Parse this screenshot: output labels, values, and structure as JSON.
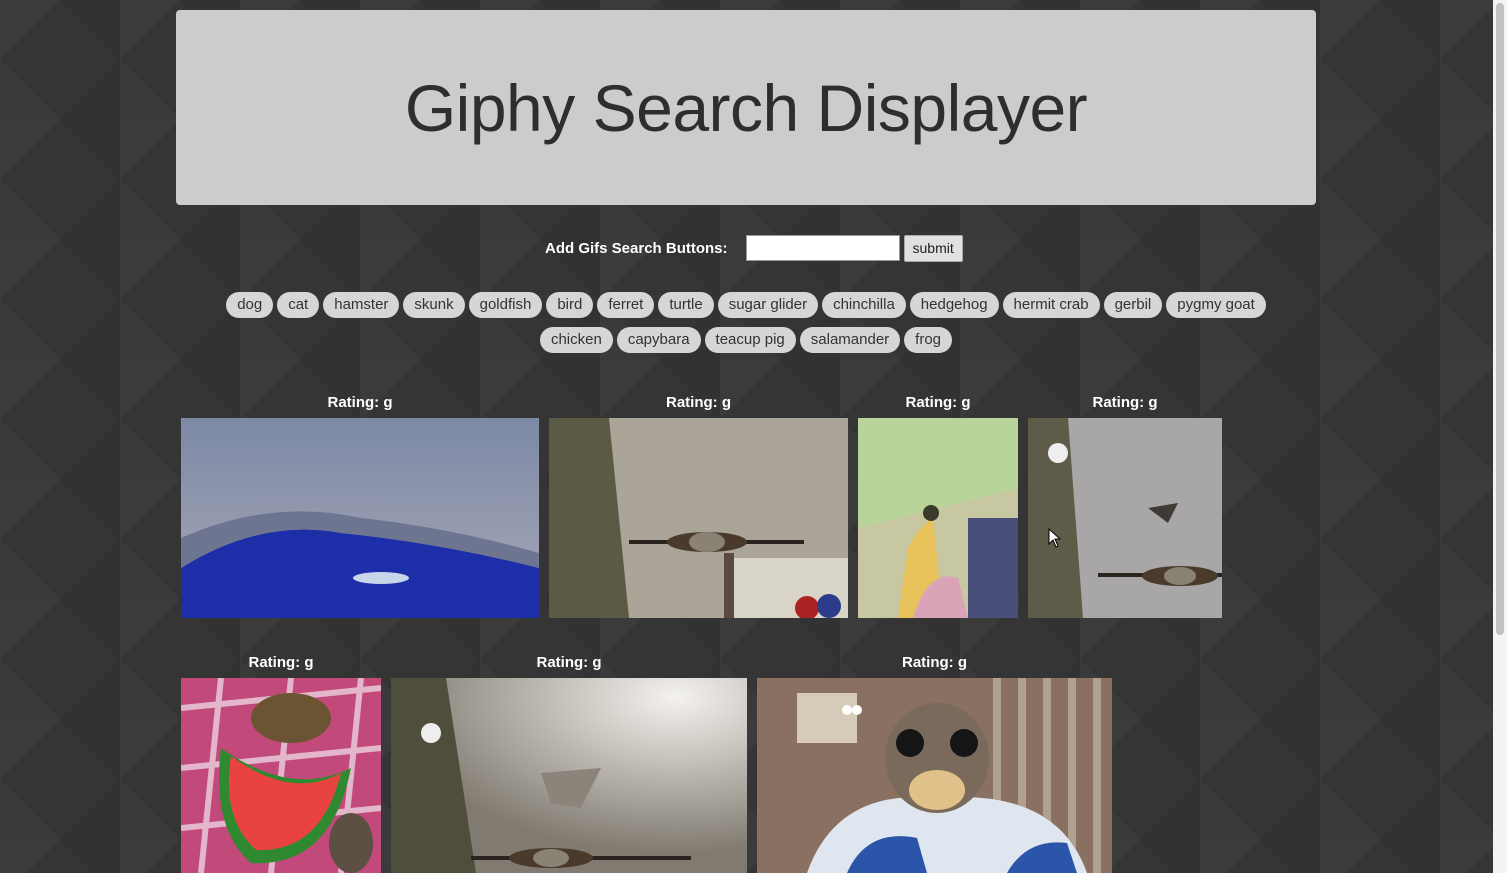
{
  "header": {
    "title": "Giphy Search Displayer"
  },
  "form": {
    "label": "Add Gifs Search Buttons:",
    "input_value": "",
    "submit_label": "submit"
  },
  "search_buttons": [
    "dog",
    "cat",
    "hamster",
    "skunk",
    "goldfish",
    "bird",
    "ferret",
    "turtle",
    "sugar glider",
    "chinchilla",
    "hedgehog",
    "hermit crab",
    "gerbil",
    "pygmy goat",
    "chicken",
    "capybara",
    "teacup pig",
    "salamander",
    "frog"
  ],
  "gifs": [
    {
      "rating": "Rating: g"
    },
    {
      "rating": "Rating: g"
    },
    {
      "rating": "Rating: g"
    },
    {
      "rating": "Rating: g"
    },
    {
      "rating": "Rating: g"
    },
    {
      "rating": "Rating: g"
    },
    {
      "rating": "Rating: g"
    }
  ],
  "colors": {
    "background": "#353535",
    "header": "#cccccc",
    "button": "#d6d6d6"
  },
  "icons": [
    "mouse-cursor-icon"
  ]
}
